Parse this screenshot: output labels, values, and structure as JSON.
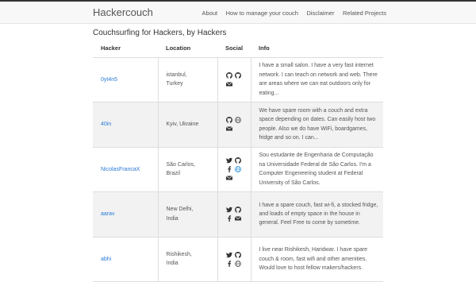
{
  "brand": "Hackercouch",
  "nav": [
    "About",
    "How to manage your couch",
    "Disclaimer",
    "Related Projects"
  ],
  "page_title": "Couchsurfing for Hackers, by Hackers",
  "columns": [
    "Hacker",
    "Location",
    "Social",
    "Info"
  ],
  "rows": [
    {
      "hacker": "0yt4n5",
      "location": [
        "istanbul,",
        "Turkey"
      ],
      "social": [
        [
          "github-icon",
          "github-icon"
        ],
        [
          "email-icon"
        ]
      ],
      "info": "I have a small salon. I have a very fast internet network. I can teach on network and web. There are areas where we can eat outdoors only for eating..."
    },
    {
      "hacker": "40in",
      "location": [
        "Kyiv, Ukraine"
      ],
      "social": [
        [
          "github-icon",
          "globe-icon"
        ],
        [
          "email-icon"
        ]
      ],
      "info": "We have spare room with a couch and extra space depending on dates. Can easily host two people. Also we do have WiFi, boardgames, fridge and so on. I can..."
    },
    {
      "hacker": "NicolasFrancaX",
      "location": [
        "São Carlos,",
        "Brazil"
      ],
      "social": [
        [
          "twitter-icon",
          "github-icon"
        ],
        [
          "facebook-icon",
          "globe-icon"
        ],
        [
          "email-icon"
        ]
      ],
      "info": "Sou estudante de Engenharia de Computação na Universidade Federal de São Carlos. I'm a Computer Engeneering student at Federal University of São Carlos."
    },
    {
      "hacker": "aarav",
      "location": [
        "New Delhi,",
        "India"
      ],
      "social": [
        [
          "twitter-icon",
          "github-icon"
        ],
        [
          "facebook-icon",
          "email-icon"
        ]
      ],
      "info": "I have a spare couch, fast wi-fi, a stocked fridge, and loads of empty space in the house in general. Feel Free to come by sometime."
    },
    {
      "hacker": "abhi",
      "location": [
        "Rishikesh,",
        "India"
      ],
      "social": [
        [
          "twitter-icon",
          "github-icon"
        ],
        [
          "facebook-icon",
          "globe-icon"
        ]
      ],
      "info": "I live near Rishikesh, Haridwar. I have spare couch & room, fast wifi and other amenities. Would love to host fellow makers/hackers."
    }
  ]
}
